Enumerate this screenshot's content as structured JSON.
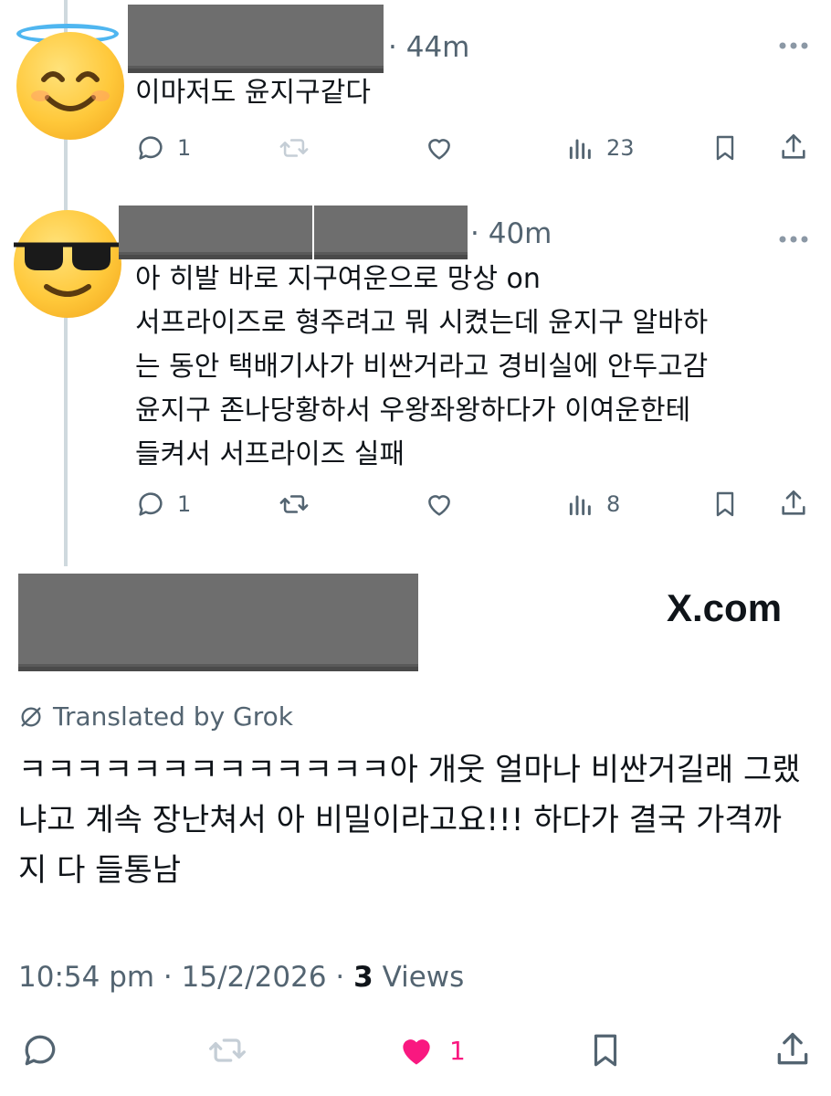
{
  "reply1": {
    "time": "44m",
    "text": "이마저도 윤지구같다",
    "stats": {
      "replies": "1",
      "views": "23"
    }
  },
  "reply2": {
    "time": "40m",
    "text": "아 히발 바로 지구여운으로 망상 on\n서프라이즈로 형주려고 뭐 시켰는데 윤지구 알바하\n는 동안 택배기사가 비싼거라고 경비실에 안두고감\n윤지구 존나당황하서 우왕좌왕하다가 이여운한테\n들켜서 서프라이즈 실패",
    "stats": {
      "replies": "1",
      "views": "8"
    }
  },
  "main": {
    "source": "X.com",
    "translated_label": "Translated by Grok",
    "text": "ㅋㅋㅋㅋㅋㅋㅋㅋㅋㅋㅋㅋㅋ아 개웃 얼마나 비싼거길래 그랬냐고 계속 장난쳐서 아 비밀이라고요!!! 하다가 결국 가격까지 다 들통남",
    "timestamp": "10:54 pm · 15/2/2026 · ",
    "views_count": "3",
    "views_label": " Views",
    "likes": "1"
  },
  "colors": {
    "like_active": "#f91880",
    "muted": "#536471",
    "thread_line": "#cfd9de"
  },
  "icons": [
    "reply-icon",
    "repost-icon",
    "like-icon",
    "views-icon",
    "bookmark-icon",
    "share-icon",
    "more-icon",
    "translate-icon"
  ]
}
